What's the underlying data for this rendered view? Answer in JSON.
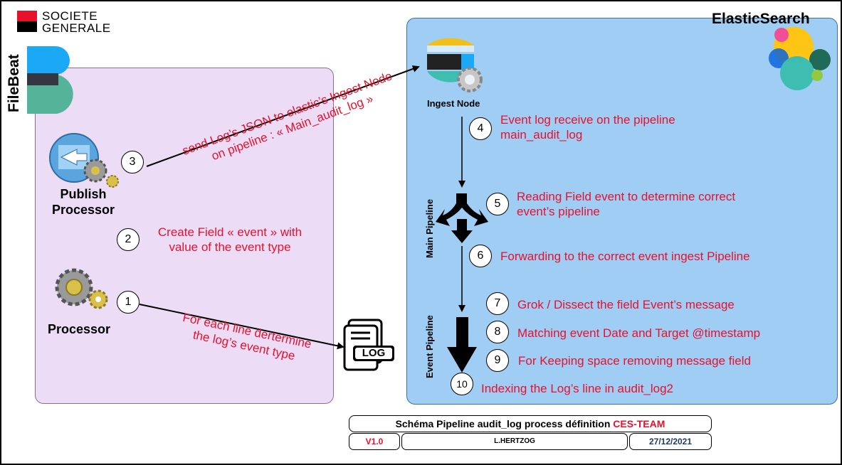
{
  "brand": {
    "line1": "SOCIETE",
    "line2": "GENERALE"
  },
  "filebeat": {
    "title": "FileBeat",
    "publish_processor": {
      "line1": "Publish",
      "line2": "Processor"
    },
    "processor": "Processor"
  },
  "elastic": {
    "title": "ElasticSearch",
    "ingest_node": "Ingest Node",
    "main_pipeline_label": "Main Pipeline",
    "event_pipeline_label": "Event Pipeline"
  },
  "steps": [
    {
      "num": "1",
      "line1": "For each line dertermine",
      "line2": "the log’s event type"
    },
    {
      "num": "2",
      "line1": "Create Field « event » with",
      "line2": "value of the event type"
    },
    {
      "num": "3",
      "line1": "send Log’s JSON to elastic’s Ingest Node",
      "line2": "on pipeline : « Main_audit_log »"
    },
    {
      "num": "4",
      "line1": "Event log receive on the pipeline",
      "line2": "main_audit_log"
    },
    {
      "num": "5",
      "line1": "Reading Field event to determine correct",
      "line2": "event’s pipeline"
    },
    {
      "num": "6",
      "line1": "Forwarding to the correct event ingest Pipeline"
    },
    {
      "num": "7",
      "line1": "Grok / Dissect the field Event’s message"
    },
    {
      "num": "8",
      "line1": "Matching event Date and Target @timestamp"
    },
    {
      "num": "9",
      "line1": "For Keeping space removing message field"
    },
    {
      "num": "10",
      "line1": "Indexing the Log’s line in audit_log2"
    }
  ],
  "log_icon_text": "LOG",
  "footer": {
    "title_prefix": "Schéma Pipeline audit_log process définition ",
    "title_team": "CES-TEAM",
    "version": "V1.0",
    "author": "L.HERTZOG",
    "date": "27/12/2021"
  },
  "colors": {
    "annotation_red": "#e8112d",
    "filebeat_bg": "#ecdcf6",
    "elastic_bg": "#9fcdf4"
  }
}
